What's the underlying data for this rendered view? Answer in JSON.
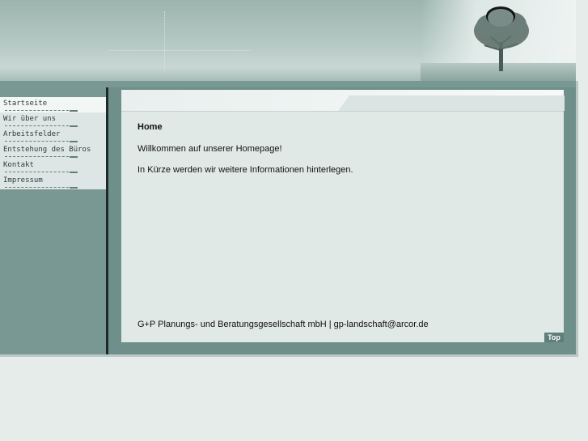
{
  "navigation": {
    "items": [
      {
        "label": "Startseite",
        "active": true
      },
      {
        "label": "Wir über uns",
        "active": false
      },
      {
        "label": "Arbeitsfelder",
        "active": false
      },
      {
        "label": "Entstehung des Büros",
        "active": false
      },
      {
        "label": "Kontakt",
        "active": false
      },
      {
        "label": "Impressum",
        "active": false
      }
    ]
  },
  "content": {
    "title": "Home",
    "intro": "Willkommen auf unserer Homepage!",
    "info": "In Kürze werden wir weitere Informationen hinterlegen."
  },
  "footer": {
    "text": "G+P Planungs- und Beratungsgesellschaft mbH | gp-landschaft@arcor.de",
    "top_label": "Top"
  },
  "colors": {
    "header_teal": "#9bb4ae",
    "frame_teal": "#6f8f8a",
    "panel_bg": "#e1e9e7",
    "page_bg": "#e6ecea"
  },
  "icons": {
    "header_image": "tree-icon"
  }
}
